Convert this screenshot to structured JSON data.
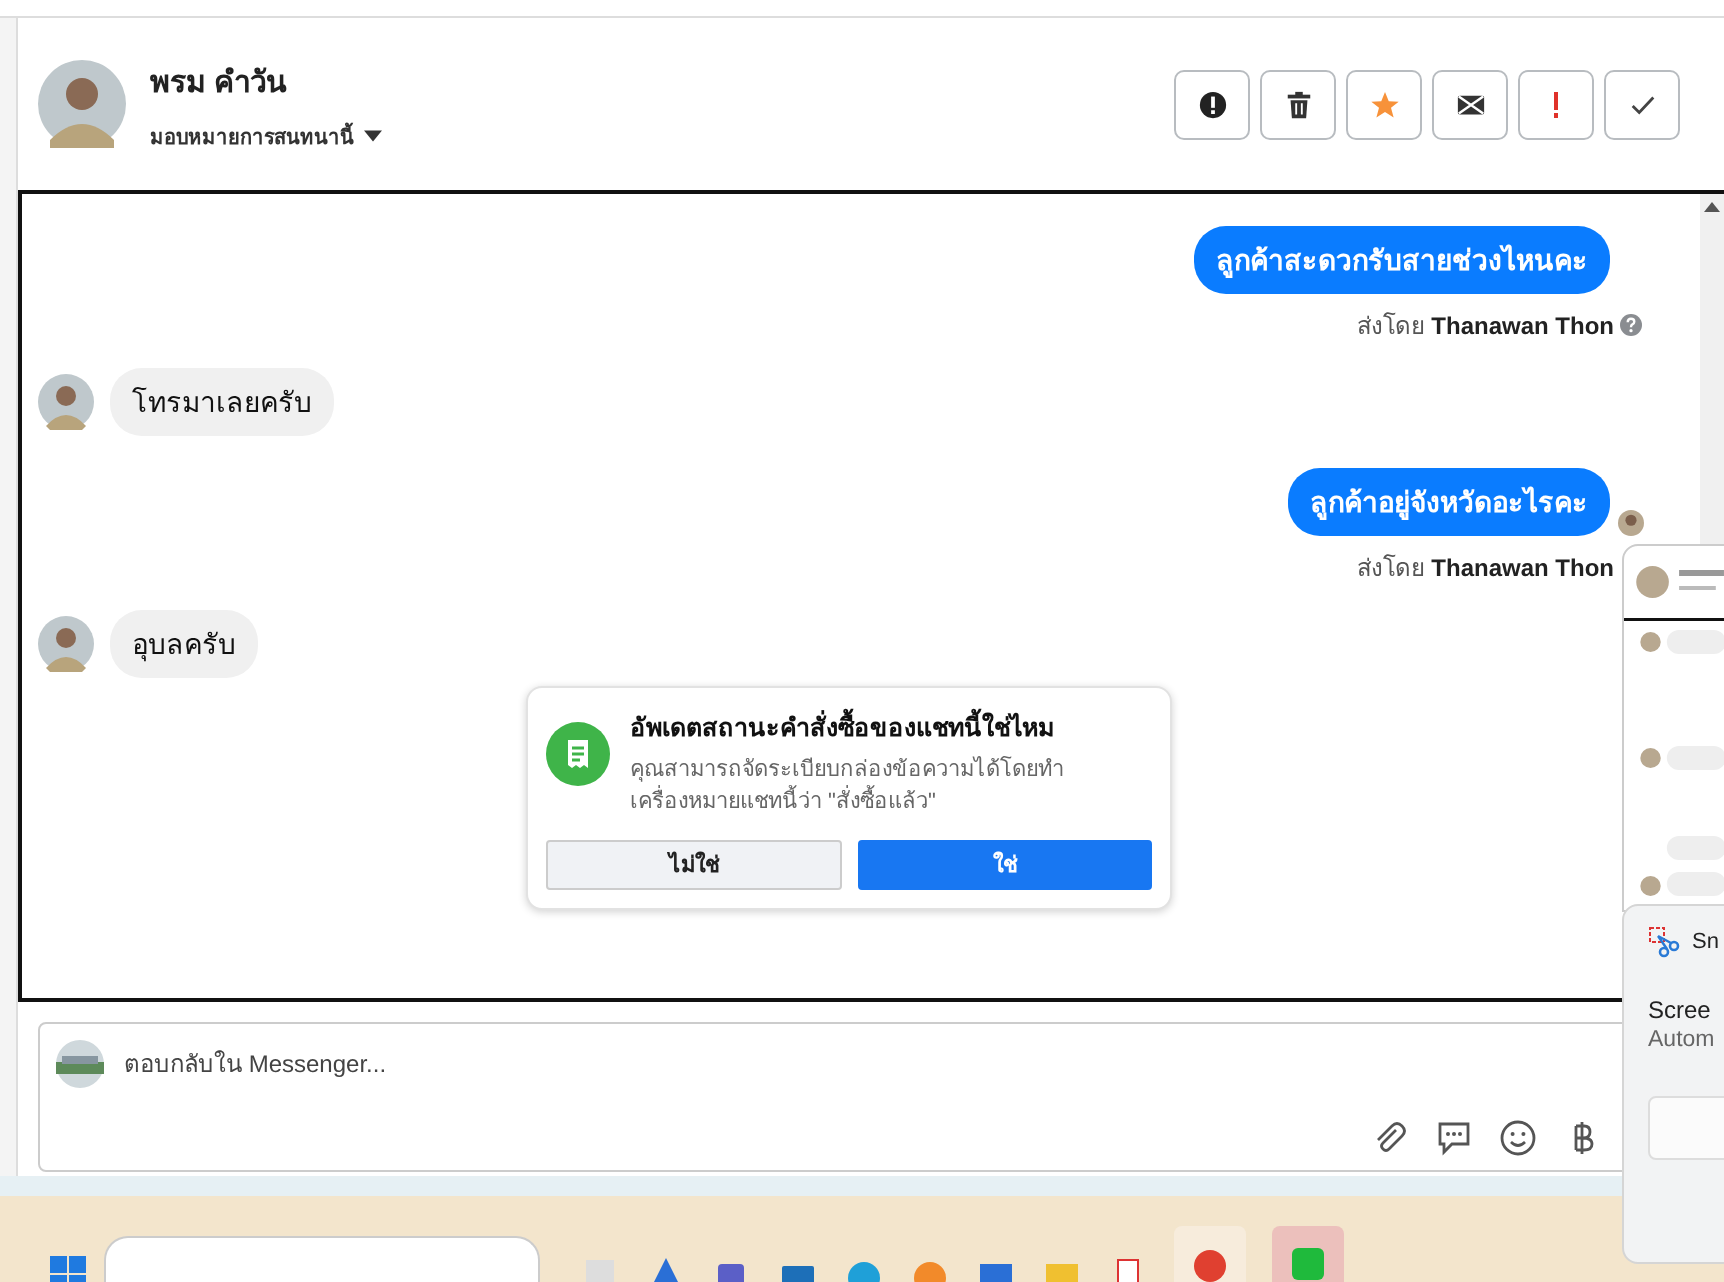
{
  "contact": {
    "name": "พรม คำวัน",
    "subtitle": "มอบหมายการสนทนานี้"
  },
  "actions": [
    {
      "kind": "alert"
    },
    {
      "kind": "trash"
    },
    {
      "kind": "star"
    },
    {
      "kind": "mail"
    },
    {
      "kind": "exclaim"
    },
    {
      "kind": "check"
    }
  ],
  "messages": [
    {
      "kind": "sent",
      "text": "ลูกค้าสะดวกรับสายช่วงไหนคะ",
      "sender_prefix": "ส่งโดย",
      "sender": "Thanawan Thon",
      "help_icon": true,
      "seen": false
    },
    {
      "kind": "received",
      "text": "โทรมาเลยครับ"
    },
    {
      "kind": "sent",
      "text": "ลูกค้าอยู่จังหวัดอะไรคะ",
      "sender_prefix": "ส่งโดย",
      "sender": "Thanawan Thon",
      "help_icon": false,
      "seen": true
    },
    {
      "kind": "received",
      "text": "อุบลครับ"
    }
  ],
  "dialog": {
    "title": "อัพเดตสถานะคำสั่งซื้อของแชทนี้ใช่ไหม",
    "body": "คุณสามารถจัดระเบียบกล่องข้อความได้โดยทำเครื่องหมายแชทนี้ว่า \"สั่งซื้อแล้ว\"",
    "buttons": [
      {
        "label": "ไม่ใช่",
        "primary": false
      },
      {
        "label": "ใช่",
        "primary": true
      }
    ]
  },
  "composer": {
    "placeholder": "ตอบกลับใน Messenger...",
    "tools": [
      {
        "kind": "attach"
      },
      {
        "kind": "comment"
      },
      {
        "kind": "emoji"
      },
      {
        "kind": "baht"
      }
    ]
  },
  "notification": {
    "app": "Sn",
    "title": "Scree",
    "subtitle": "Autom"
  }
}
